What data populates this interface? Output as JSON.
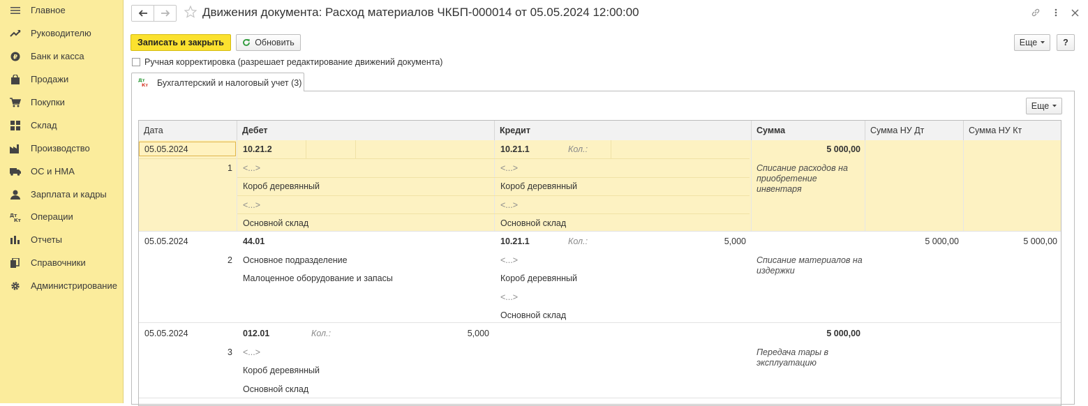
{
  "sidebar": {
    "items": [
      {
        "label": "Главное",
        "icon": "menu-icon"
      },
      {
        "label": "Руководителю",
        "icon": "trend-icon"
      },
      {
        "label": "Банк и касса",
        "icon": "ruble-icon"
      },
      {
        "label": "Продажи",
        "icon": "bag-icon"
      },
      {
        "label": "Покупки",
        "icon": "cart-icon"
      },
      {
        "label": "Склад",
        "icon": "warehouse-icon"
      },
      {
        "label": "Производство",
        "icon": "factory-icon"
      },
      {
        "label": "ОС и НМА",
        "icon": "truck-icon"
      },
      {
        "label": "Зарплата и кадры",
        "icon": "person-icon"
      },
      {
        "label": "Операции",
        "icon": "dt-kt-icon"
      },
      {
        "label": "Отчеты",
        "icon": "bar-chart-icon"
      },
      {
        "label": "Справочники",
        "icon": "books-icon"
      },
      {
        "label": "Администрирование",
        "icon": "gear-icon"
      }
    ]
  },
  "header": {
    "title": "Движения документа: Расход материалов ЧКБП-000014 от 05.05.2024 12:00:00"
  },
  "toolbar": {
    "save_close": "Записать и закрыть",
    "refresh": "Обновить",
    "more": "Еще",
    "help": "?"
  },
  "manual_correction": {
    "label": "Ручная корректировка (разрешает редактирование движений документа)",
    "checked": false
  },
  "tabs": [
    {
      "label": "Бухгалтерский и налоговый учет (3)",
      "icon": "dt-kt-icon"
    }
  ],
  "table": {
    "more": "Еще",
    "columns": [
      "Дата",
      "Дебет",
      "Кредит",
      "Сумма",
      "Сумма НУ Дт",
      "Сумма НУ Кт"
    ],
    "qty_label": "Кол.:",
    "rows": [
      {
        "date": "05.05.2024",
        "num": "1",
        "debit_account": "10.21.2",
        "debit_qty": "",
        "debit_sub": [
          "<...>",
          "Короб деревянный",
          "<...>",
          "Основной склад"
        ],
        "credit_account": "10.21.1",
        "credit_qty_label": "Кол.:",
        "credit_qty": "",
        "credit_sub": [
          "<...>",
          "Короб деревянный",
          "<...>",
          "Основной склад"
        ],
        "sum": "5 000,00",
        "description": [
          "Списание расходов на",
          "приобретение",
          "инвентаря"
        ],
        "nu_dt": "",
        "nu_kt": ""
      },
      {
        "date": "05.05.2024",
        "num": "2",
        "debit_account": "44.01",
        "debit_qty": "",
        "debit_sub": [
          "Основное подразделение",
          "Малоценное оборудование и запасы"
        ],
        "credit_account": "10.21.1",
        "credit_qty_label": "Кол.:",
        "credit_qty": "5,000",
        "credit_sub": [
          "<...>",
          "Короб деревянный",
          "<...>",
          "Основной склад"
        ],
        "sum": "",
        "description": [
          "Списание материалов на",
          "издержки"
        ],
        "nu_dt": "5 000,00",
        "nu_kt": "5 000,00"
      },
      {
        "date": "05.05.2024",
        "num": "3",
        "debit_account": "012.01",
        "debit_qty_label": "Кол.:",
        "debit_qty": "5,000",
        "debit_sub": [
          "<...>",
          "Короб деревянный",
          "Основной склад"
        ],
        "credit_account": "",
        "credit_sub": [],
        "sum": "5 000,00",
        "description": [
          "Передача тары в",
          "эксплуатацию"
        ],
        "nu_dt": "",
        "nu_kt": ""
      }
    ]
  }
}
